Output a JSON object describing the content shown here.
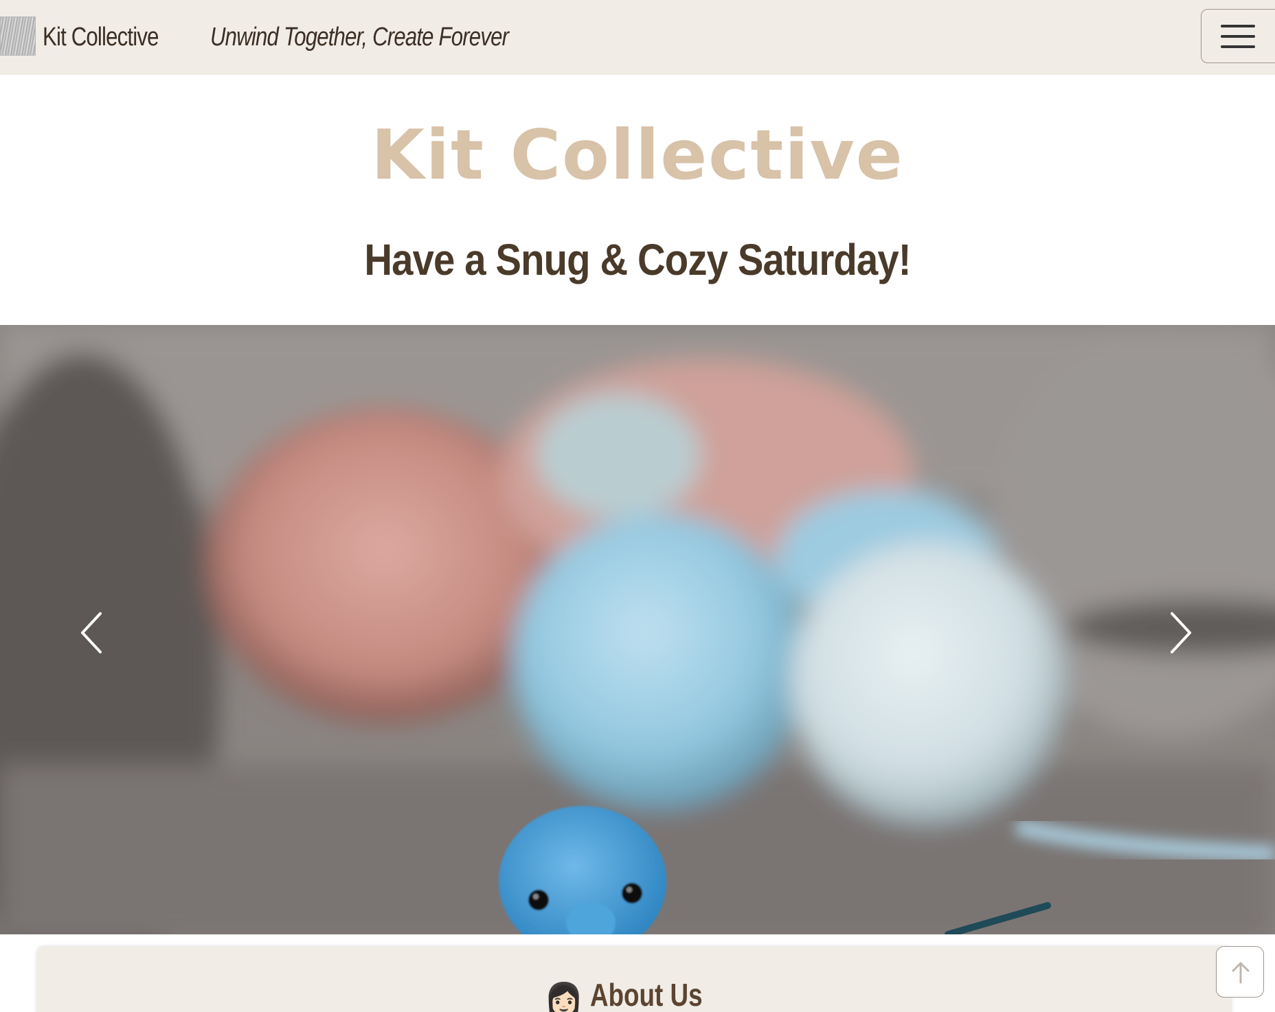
{
  "navbar": {
    "brand_name": "Kit Collective",
    "tagline": "Unwind Together, Create Forever",
    "menu_icon": "hamburger-menu-icon"
  },
  "hero": {
    "title": "Kit Collective",
    "greeting": "Have a Snug & Cozy Saturday!"
  },
  "carousel": {
    "prev_icon": "chevron-left-icon",
    "next_icon": "chevron-right-icon"
  },
  "about": {
    "emoji": "👩🏻",
    "title": "About Us"
  },
  "back_to_top": {
    "icon": "arrow-up-icon"
  },
  "colors": {
    "navbar_bg": "#f1ece6",
    "title_color": "#d8c2a8",
    "text_dark": "#4a3a2a"
  }
}
